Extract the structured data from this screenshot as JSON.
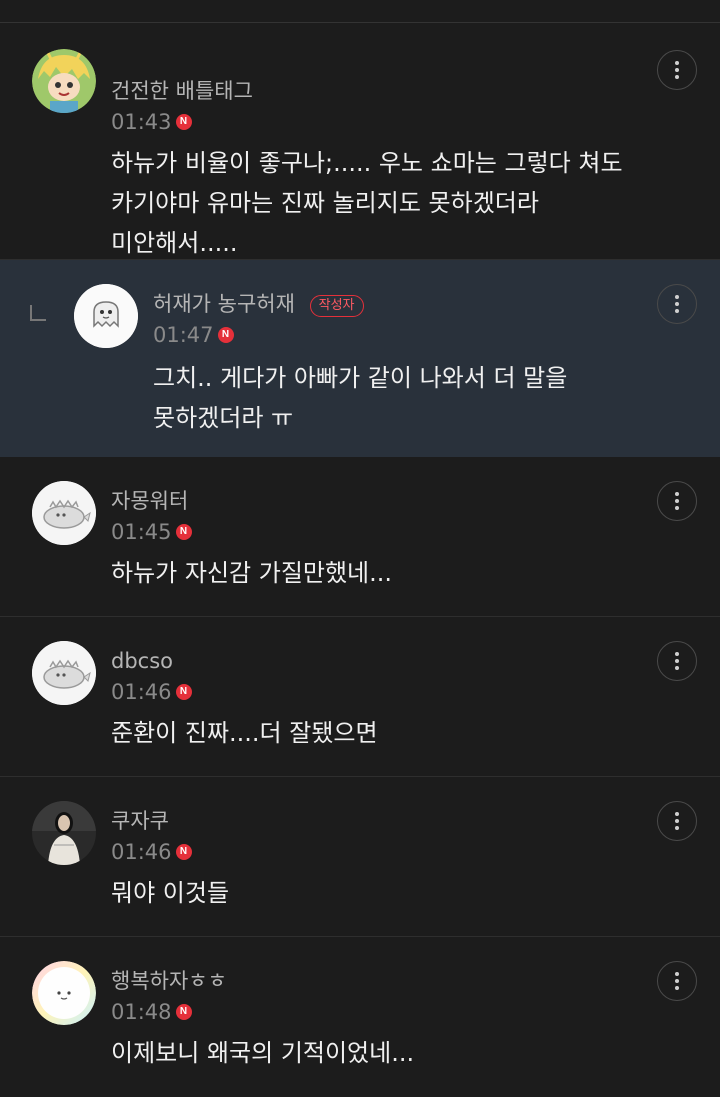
{
  "comments": [
    {
      "nickname": "건전한 배틀태그",
      "time": "01:43",
      "new_badge": "N",
      "text": "하뉴가 비율이 좋구나;..... 우노 쇼마는 그렇다 쳐도\n카기야마 유마는 진짜 놀리지도 못하겠더라\n미안해서.....",
      "avatar": "cartoon-character"
    },
    {
      "nickname": "허재가 농구허재",
      "author_badge": "작성자",
      "time": "01:47",
      "new_badge": "N",
      "text": "그치.. 게다가 아빠가 같이 나와서 더 말을\n못하겠더라 ㅠ",
      "avatar": "ghost-character",
      "is_reply": true
    },
    {
      "nickname": "자몽워터",
      "time": "01:45",
      "new_badge": "N",
      "text": "하뉴가 자신감 가질만했네...",
      "avatar": "default-dino"
    },
    {
      "nickname": "dbcso",
      "time": "01:46",
      "new_badge": "N",
      "text": "준환이 진짜....더 잘됐으면",
      "avatar": "default-dino"
    },
    {
      "nickname": "쿠자쿠",
      "time": "01:46",
      "new_badge": "N",
      "text": "뭐야 이것들",
      "avatar": "photo-person"
    },
    {
      "nickname": "행복하자ㅎㅎ",
      "time": "01:48",
      "new_badge": "N",
      "text": "이제보니 왜국의 기적이었네...",
      "avatar": "smiley-character"
    }
  ],
  "colors": {
    "background": "#1c1c1c",
    "reply_background": "#29313b",
    "badge_red": "#e5303a"
  }
}
